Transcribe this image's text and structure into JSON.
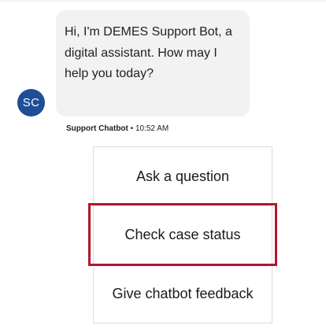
{
  "chat": {
    "message": "Hi, I'm DEMES Support Bot, a digital assistant. How may I help you today?",
    "avatar_initials": "SC",
    "author": "Support Chatbot",
    "separator": " • ",
    "time": "10:52 AM"
  },
  "options": [
    {
      "label": "Ask a question"
    },
    {
      "label": "Check case status",
      "highlighted": true
    },
    {
      "label": "Give chatbot feedback"
    }
  ],
  "colors": {
    "avatar": "#1f4e96",
    "bubble": "#f2f2f2",
    "highlight": "#b3172b"
  }
}
